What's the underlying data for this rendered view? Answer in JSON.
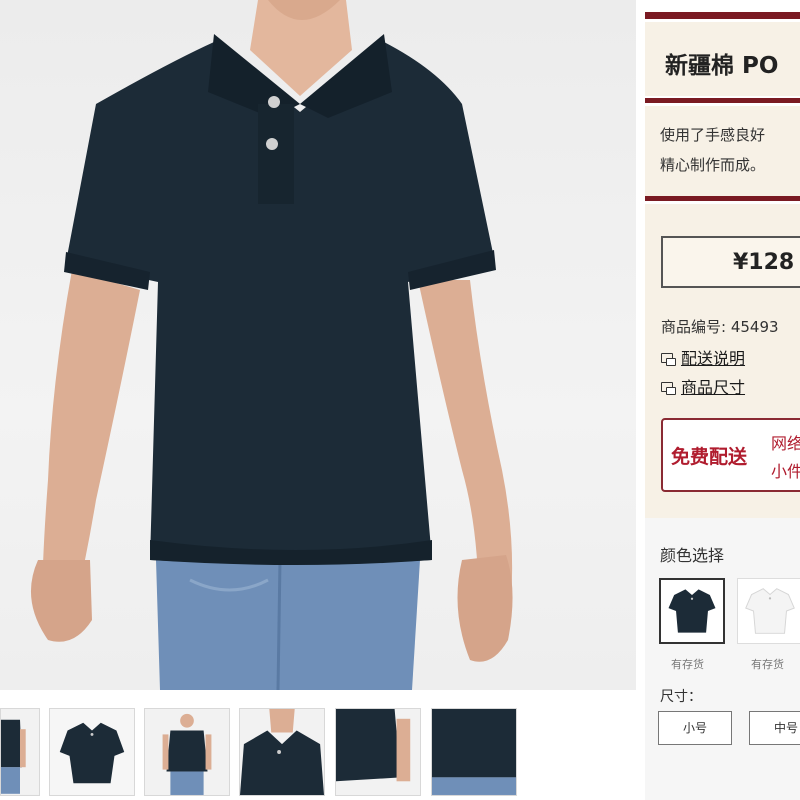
{
  "product": {
    "title": "新疆棉  PO",
    "description_line1": "使用了手感良好",
    "description_line2": "精心制作而成。",
    "price": "¥128",
    "item_number": "商品编号: 45493"
  },
  "links": {
    "delivery": "配送说明",
    "size_chart": "商品尺寸"
  },
  "promo": {
    "free_shipping": "免费配送",
    "note_line1": "网络",
    "note_line2": "小件"
  },
  "options": {
    "color_label": "颜色选择",
    "colors": [
      {
        "name": "navy",
        "hex": "#1c2b37",
        "stock": "有存货",
        "selected": true
      },
      {
        "name": "white",
        "hex": "#f4f4f4",
        "stock": "有存货",
        "selected": false
      }
    ],
    "size_label": "尺寸：",
    "sizes": [
      {
        "label": "小号"
      },
      {
        "label": "中号"
      }
    ]
  },
  "colors": {
    "accent": "#7a1a22",
    "promo_text": "#b01c2e",
    "panel_bg": "#f7f1e6",
    "shirt": "#1c2b37",
    "jeans": "#6f8fb8"
  },
  "icons": {
    "link_icon": "speech-bubbles-icon"
  }
}
